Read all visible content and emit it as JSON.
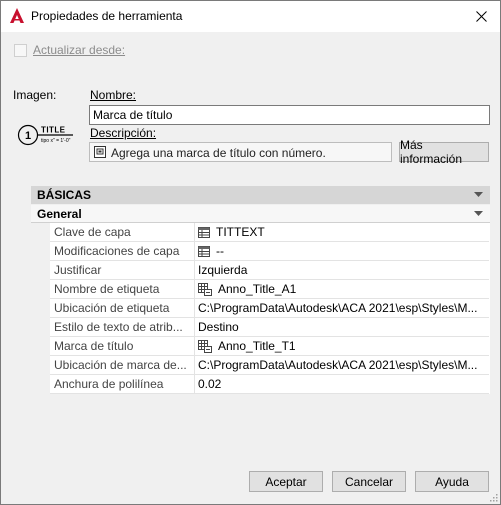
{
  "window": {
    "title": "Propiedades de herramienta",
    "close_glyph": "✕"
  },
  "refresh": {
    "label": "Actualizar desde:",
    "checked": false
  },
  "image": {
    "label": "Imagen:",
    "preview_number": "1",
    "preview_title": "TITLE",
    "preview_subtitle": "tipo x\" = 1'-0\""
  },
  "name": {
    "label": "Nombre:",
    "value": "Marca de título"
  },
  "description": {
    "label": "Descripción:",
    "value": "Agrega una marca de título con número.",
    "more_info_button": "Más información"
  },
  "sections": {
    "basic": "BÁSICAS",
    "general": "General"
  },
  "properties": [
    {
      "label": "Clave de capa",
      "value": "TITTEXT",
      "icon": "table-icon"
    },
    {
      "label": "Modificaciones de capa",
      "value": "--",
      "icon": "table-icon"
    },
    {
      "label": "Justificar",
      "value": "Izquierda",
      "icon": ""
    },
    {
      "label": "Nombre de etiqueta",
      "value": "Anno_Title_A1",
      "icon": "block-icon"
    },
    {
      "label": "Ubicación de etiqueta",
      "value": "C:\\ProgramData\\Autodesk\\ACA  2021\\esp\\Styles\\M...",
      "icon": ""
    },
    {
      "label": "Estilo de texto de atrib...",
      "value": "Destino",
      "icon": ""
    },
    {
      "label": "Marca de título",
      "value": "Anno_Title_T1",
      "icon": "block-icon"
    },
    {
      "label": "Ubicación de marca de...",
      "value": "C:\\ProgramData\\Autodesk\\ACA  2021\\esp\\Styles\\M...",
      "icon": ""
    },
    {
      "label": "Anchura de polilínea",
      "value": "0.02",
      "icon": ""
    }
  ],
  "buttons": {
    "accept": "Aceptar",
    "cancel": "Cancelar",
    "help": "Ayuda"
  },
  "colors": {
    "accent_red": "#c8102e",
    "section_header": "#d6d6d6",
    "background": "#f0f0f0"
  }
}
